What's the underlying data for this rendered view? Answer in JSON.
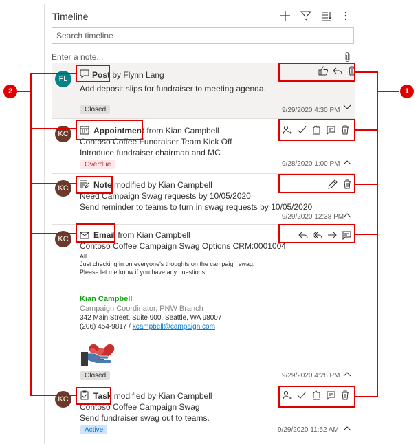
{
  "header": {
    "title": "Timeline",
    "search_placeholder": "Search timeline",
    "note_placeholder": "Enter a note..."
  },
  "callouts": {
    "one": "1",
    "two": "2"
  },
  "records": [
    {
      "avatar": "FL",
      "avatar_color": "#038387",
      "type": "Post",
      "title_rest": " by Flynn Lang",
      "line1": "Add deposit slips for fundraiser to meeting agenda.",
      "badge": "Closed",
      "date": "9/29/2020 4:30 PM"
    },
    {
      "avatar": "KC",
      "avatar_color": "#6b3a2a",
      "type": "Appointment",
      "title_rest": " from Kian Campbell",
      "line1": "Contoso Coffee Fundraiser Team Kick Off",
      "line2": "Introduce fundraiser chairman and MC",
      "badge": "Overdue",
      "date": "9/28/2020 1:00 PM"
    },
    {
      "avatar": "KC",
      "avatar_color": "#6b3a2a",
      "type": "Note",
      "title_rest": " modified by Kian Campbell",
      "line1": "Need Campaign Swag requests by 10/05/2020",
      "line2": "Send reminder to teams to turn in swag requests by 10/05/2020",
      "date": "9/29/2020 12:38 PM"
    },
    {
      "avatar": "KC",
      "avatar_color": "#6b3a2a",
      "type": "Email",
      "title_rest": " from Kian Campbell",
      "line1": "Contoso Coffee Campaign Swag Options CRM:0001004",
      "body1": "All",
      "body2": "Just checking in on everyone's thoughts on the campaign swag.",
      "body3": "Please let me know if you have any questions!",
      "sig_name": "Kian Campbell",
      "sig_role": "Campaign Coordinator, PNW Branch",
      "sig_address": "342 Main Street, Suite 900, Seattle, WA 98007",
      "sig_phone": "(206) 454-9817 / ",
      "sig_email": "kcampbell@campaign.com",
      "badge": "Closed",
      "date": "9/29/2020 4:28 PM"
    },
    {
      "avatar": "KC",
      "avatar_color": "#6b3a2a",
      "type": "Task",
      "title_rest": " modified by Kian Campbell",
      "line1": "Contoso Coffee Campaign Swag",
      "line2": "Send fundraiser swag out to teams.",
      "badge": "Active",
      "date": "9/29/2020 11:52 AM"
    }
  ],
  "colors": {
    "callout": "#e00000",
    "sig_name": "#13a10e",
    "active_badge_bg": "#cfe4fa",
    "overdue_text": "#a4262c"
  }
}
